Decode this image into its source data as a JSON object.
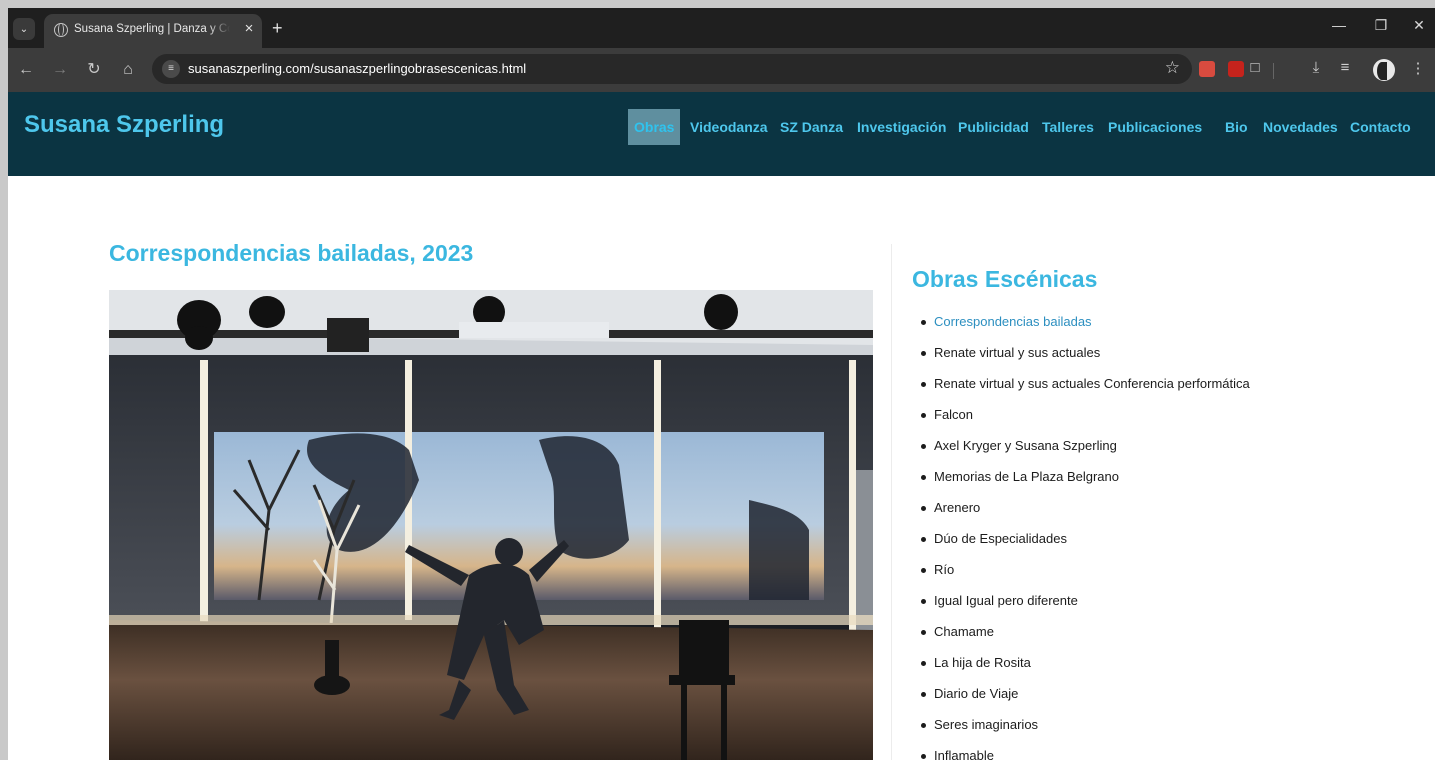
{
  "browser": {
    "tab_title": "Susana Szperling | Danza y Coreografía",
    "url": "susanaszperling.com/susanaszperlingobrasescenicas.html",
    "icons": {
      "tab_dropdown": "chevron-down-icon",
      "favicon": "globe-icon",
      "close": "close-icon",
      "new_tab": "plus-icon",
      "back": "arrow-left-icon",
      "forward": "arrow-right-icon",
      "reload": "reload-icon",
      "home": "home-icon",
      "bookmark": "star-icon",
      "download": "download-icon",
      "media": "media-controls-icon",
      "menu": "kebab-menu-icon"
    }
  },
  "site": {
    "title": "Susana Szperling",
    "nav": [
      "Obras",
      "Videodanza",
      "SZ Danza",
      "Investigación",
      "Publicidad",
      "Talleres",
      "Publicaciones",
      "Bio",
      "Novedades",
      "Contacto"
    ],
    "active_nav": "Obras",
    "colors": {
      "header_bg": "#0b3442",
      "accent": "#3bb7e0",
      "active_bg": "#5f8f9f"
    }
  },
  "article": {
    "title": "Correspondencias bailadas, 2023"
  },
  "sidebar": {
    "title": "Obras Escénicas",
    "items": [
      "Correspondencias bailadas",
      "Renate virtual y sus actuales",
      "Renate virtual y sus actuales Conferencia performática",
      "Falcon",
      "Axel Kryger y Susana Szperling",
      "Memorias de La Plaza Belgrano",
      "Arenero",
      "Dúo de Especialidades",
      "Río",
      "Igual Igual pero diferente",
      "Chamame",
      "La hija de Rosita",
      "Diario de Viaje",
      "Seres imaginarios",
      "Inflamable"
    ]
  }
}
